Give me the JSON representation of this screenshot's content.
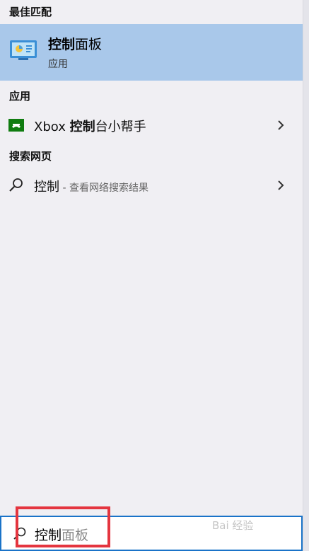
{
  "sections": {
    "best_match": "最佳匹配",
    "apps": "应用",
    "web": "搜索网页"
  },
  "best_match_item": {
    "title_bold": "控制",
    "title_rest": "面板",
    "subtitle": "应用",
    "icon": "control-panel-icon"
  },
  "app_item": {
    "prefix": "Xbox ",
    "bold": "控制",
    "rest": "台小帮手",
    "icon": "xbox-icon"
  },
  "web_item": {
    "query": "控制",
    "hint": " - 查看网络搜索结果",
    "icon": "search-icon"
  },
  "search_box": {
    "typed": "控制",
    "suggestion": "面板"
  },
  "watermark": "Bai 经验",
  "colors": {
    "selected_bg": "#a9c8ea",
    "panel_bg": "#f0eff3",
    "search_border": "#1a73c8",
    "highlight": "#e4353f",
    "xbox_green": "#107c10"
  }
}
